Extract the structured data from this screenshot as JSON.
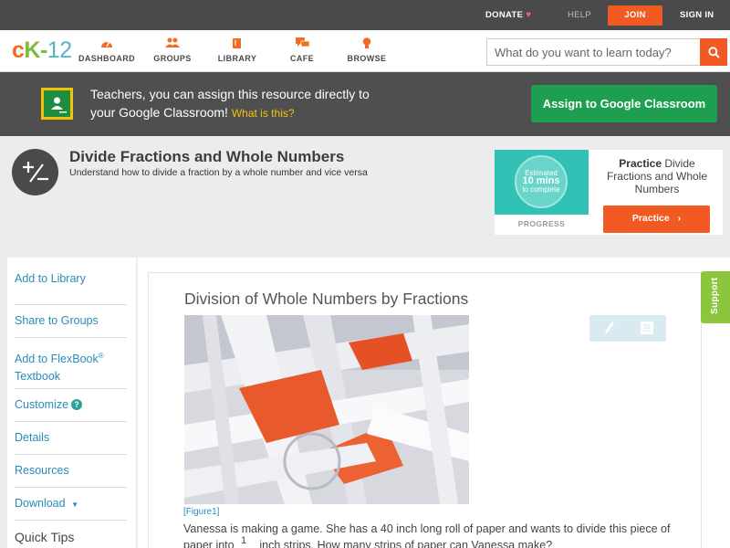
{
  "topbar": {
    "donate": "DONATE",
    "help": "HELP",
    "join": "JOIN",
    "signin": "SIGN IN"
  },
  "logo": {
    "c": "c",
    "k": "K",
    "dash": "-",
    "num": "12"
  },
  "nav": [
    {
      "label": "DASHBOARD",
      "icon": "dashboard-gauge-icon"
    },
    {
      "label": "GROUPS",
      "icon": "groups-people-icon"
    },
    {
      "label": "LIBRARY",
      "icon": "library-book-icon"
    },
    {
      "label": "CAFE",
      "icon": "cafe-chat-icon"
    },
    {
      "label": "BROWSE",
      "icon": "browse-bulb-icon"
    }
  ],
  "search": {
    "placeholder": "What do you want to learn today?",
    "icon": "search-icon"
  },
  "banner": {
    "line1": "Teachers, you can assign this resource directly to",
    "line2": "your Google Classroom!",
    "what": "What is this?",
    "button": "Assign to Google Classroom"
  },
  "concept": {
    "title": "Divide Fractions and Whole Numbers",
    "subtitle": "Understand how to divide a fraction by a whole number and vice versa"
  },
  "practice_card": {
    "estimated": "Estimated",
    "mins": "10 mins",
    "to_complete": "to complete",
    "progress": "PROGRESS",
    "text_bold": "Practice",
    "text_rest": "Divide Fractions and Whole Numbers",
    "button": "Practice"
  },
  "sidebar": {
    "items": [
      "Add to Library",
      "Share to Groups",
      "Add to FlexBook® Textbook",
      "Customize",
      "Details",
      "Resources",
      "Download"
    ],
    "add_flexbook_1": "Add to FlexBook",
    "add_flexbook_2": "Textbook",
    "download_arrow": "▼",
    "quick_tips": "Quick Tips"
  },
  "article": {
    "title": "Division of Whole Numbers by Fractions",
    "caption": "[Figure1]",
    "paragraph": "Vanessa is making a game. She has a 40 inch long roll of paper and wants to divide this piece of",
    "fraction_numerator": "1",
    "paragraph2": "paper into ___ inch strips. How many strips of paper can Vanessa make?"
  },
  "support": "Support",
  "colors": {
    "accent_orange": "#f15a22",
    "link_blue": "#2a8bb9",
    "classroom_green": "#1e9e51",
    "support_green": "#8cc63f",
    "teal": "#32c2b5"
  }
}
